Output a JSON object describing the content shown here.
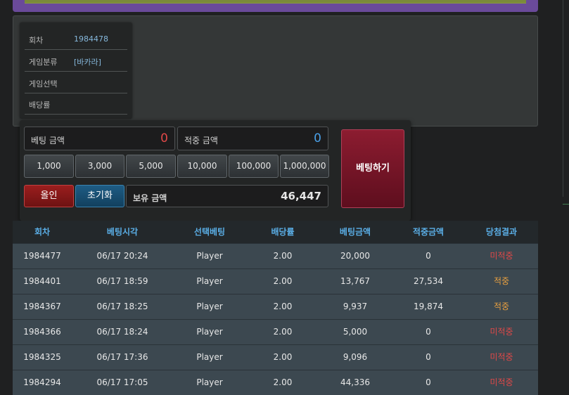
{
  "round_info": {
    "round_label": "회차",
    "round_value": "1984478",
    "category_label": "게임분류",
    "category_value": "[바카라]",
    "selection_label": "게임선택",
    "selection_value": "",
    "odds_label": "배당률",
    "odds_value": ""
  },
  "bet": {
    "bet_amount_label": "베팅 금액",
    "bet_amount_value": "0",
    "win_amount_label": "적중 금액",
    "win_amount_value": "0",
    "amount_buttons": [
      "1,000",
      "3,000",
      "5,000",
      "10,000",
      "100,000",
      "1,000,000"
    ],
    "all_in_label": "올인",
    "reset_label": "초기화",
    "balance_label": "보유 금액",
    "balance_value": "46,447",
    "place_bet_label": "베팅하기"
  },
  "history": {
    "headers": [
      "회차",
      "베팅시각",
      "선택베팅",
      "배당률",
      "베팅금액",
      "적중금액",
      "당첨결과"
    ],
    "rows": [
      [
        "1984477",
        "06/17 20:24",
        "Player",
        "2.00",
        "20,000",
        "0",
        "미적중"
      ],
      [
        "1984401",
        "06/17 18:59",
        "Player",
        "2.00",
        "13,767",
        "27,534",
        "적중"
      ],
      [
        "1984367",
        "06/17 18:25",
        "Player",
        "2.00",
        "9,937",
        "19,874",
        "적중"
      ],
      [
        "1984366",
        "06/17 18:24",
        "Player",
        "2.00",
        "5,000",
        "0",
        "미적중"
      ],
      [
        "1984325",
        "06/17 17:36",
        "Player",
        "2.00",
        "9,096",
        "0",
        "미적중"
      ],
      [
        "1984294",
        "06/17 17:05",
        "Player",
        "2.00",
        "44,336",
        "0",
        "미적중"
      ]
    ]
  },
  "colors": {
    "miss": "#e04848",
    "hit": "#e8a040",
    "header_text": "#5aaee6",
    "bet_zero": "#e04848",
    "win_zero": "#4aa0e8"
  }
}
